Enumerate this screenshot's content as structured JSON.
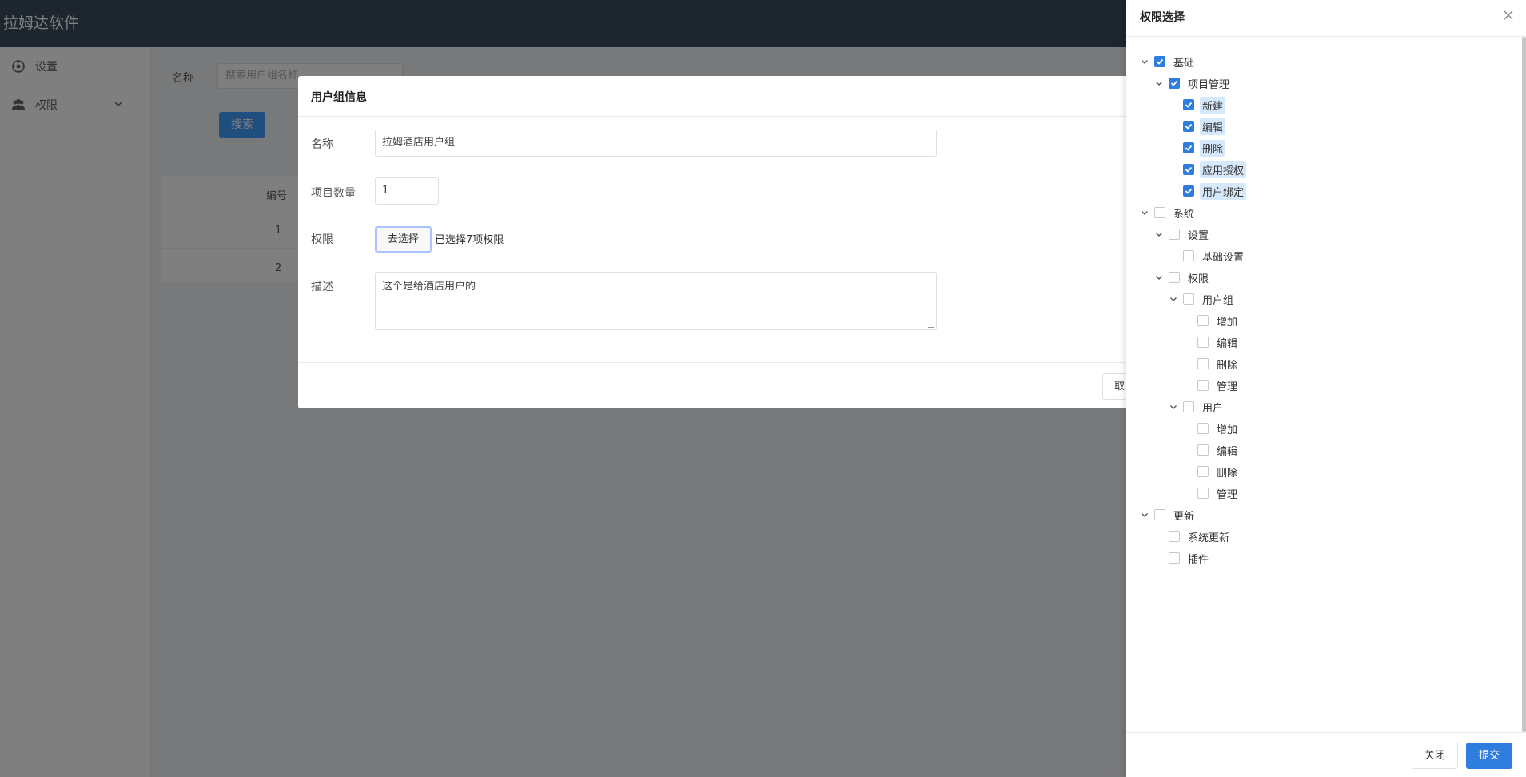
{
  "app": {
    "title": "拉姆达软件"
  },
  "sidebar": {
    "items": [
      {
        "label": "设置",
        "icon": "gear-icon"
      },
      {
        "label": "权限",
        "icon": "users-icon"
      }
    ]
  },
  "search": {
    "label": "名称",
    "placeholder": "搜索用户组名称",
    "button": "搜索"
  },
  "table": {
    "columns": [
      "编号"
    ],
    "rows": [
      {
        "id": "1"
      },
      {
        "id": "2"
      }
    ]
  },
  "dialog": {
    "title": "用户组信息",
    "fields": {
      "name_label": "名称",
      "name_value": "拉姆酒店用户组",
      "count_label": "项目数量",
      "count_value": "1",
      "perm_label": "权限",
      "perm_button": "去选择",
      "perm_status": "已选择7项权限",
      "desc_label": "描述",
      "desc_value": "这个是给酒店用户的"
    },
    "cancel_label": "取"
  },
  "drawer": {
    "title": "权限选择",
    "tree": [
      {
        "label": "基础",
        "checked": true,
        "highlight": false
      },
      {
        "label": "项目管理",
        "checked": true,
        "highlight": false
      },
      {
        "label": "新建",
        "checked": true,
        "highlight": true
      },
      {
        "label": "编辑",
        "checked": true,
        "highlight": true
      },
      {
        "label": "删除",
        "checked": true,
        "highlight": true
      },
      {
        "label": "应用授权",
        "checked": true,
        "highlight": true
      },
      {
        "label": "用户绑定",
        "checked": true,
        "highlight": true
      },
      {
        "label": "系统",
        "checked": false,
        "highlight": false
      },
      {
        "label": "设置",
        "checked": false,
        "highlight": false
      },
      {
        "label": "基础设置",
        "checked": false,
        "highlight": false
      },
      {
        "label": "权限",
        "checked": false,
        "highlight": false
      },
      {
        "label": "用户组",
        "checked": false,
        "highlight": false
      },
      {
        "label": "增加",
        "checked": false,
        "highlight": false
      },
      {
        "label": "编辑",
        "checked": false,
        "highlight": false
      },
      {
        "label": "删除",
        "checked": false,
        "highlight": false
      },
      {
        "label": "管理",
        "checked": false,
        "highlight": false
      },
      {
        "label": "用户",
        "checked": false,
        "highlight": false
      },
      {
        "label": "增加",
        "checked": false,
        "highlight": false
      },
      {
        "label": "编辑",
        "checked": false,
        "highlight": false
      },
      {
        "label": "删除",
        "checked": false,
        "highlight": false
      },
      {
        "label": "管理",
        "checked": false,
        "highlight": false
      },
      {
        "label": "更新",
        "checked": false,
        "highlight": false
      },
      {
        "label": "系统更新",
        "checked": false,
        "highlight": false
      },
      {
        "label": "插件",
        "checked": false,
        "highlight": false
      }
    ],
    "close_label": "关闭",
    "submit_label": "提交"
  },
  "colors": {
    "primary": "#2f7ddf",
    "highlight": "#d6e8fb",
    "topbar": "#3a4a5c"
  }
}
